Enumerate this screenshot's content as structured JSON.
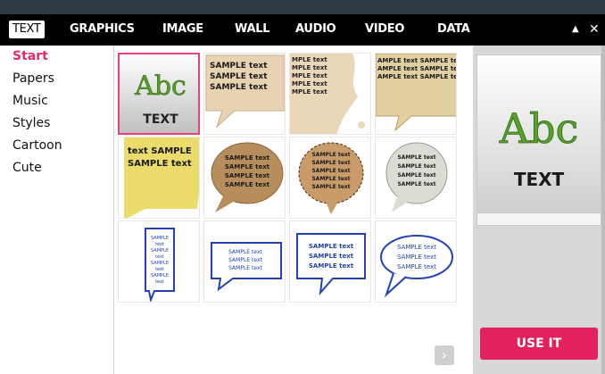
{
  "menu": {
    "tabs": [
      {
        "label": "TEXT"
      },
      {
        "label": "GRAPHICS"
      },
      {
        "label": "IMAGE"
      },
      {
        "label": "WALL"
      },
      {
        "label": "AUDIO"
      },
      {
        "label": "VIDEO"
      },
      {
        "label": "DATA"
      }
    ],
    "minimize_glyph": "▲",
    "close_glyph": "✕"
  },
  "sidebar": {
    "items": [
      {
        "label": "Start",
        "active": true
      },
      {
        "label": "Papers"
      },
      {
        "label": "Music"
      },
      {
        "label": "Styles"
      },
      {
        "label": "Cartoon"
      },
      {
        "label": "Cute"
      }
    ]
  },
  "grid": {
    "items": [
      {
        "style": "abc-text",
        "big": "Abc",
        "small": "TEXT"
      },
      {
        "style": "kraft-speech",
        "text": "SAMPLE text SAMPLE text SAMPLE text"
      },
      {
        "style": "grunge-paper",
        "text": "MPLE text MPLE text MPLE text MPLE text MPLE text"
      },
      {
        "style": "newspaper-bubble",
        "text": "AMPLE text SAMPLE te AMPLE text SAMPLE te AMPLE text SAMPLE te"
      },
      {
        "style": "sticky-note",
        "text": "text SAMPLE SAMPLE text"
      },
      {
        "style": "cardboard-speech",
        "text": "SAMPLE text SAMPLE text SAMPLE text SAMPLE text"
      },
      {
        "style": "stitched-speech",
        "text": "SAMPLE text SAMPLE text SAMPLE text SAMPLE text SAMPLE text"
      },
      {
        "style": "stone-speech",
        "text": "SAMPLE text SAMPLE text SAMPLE text SAMPLE text"
      },
      {
        "style": "blue-scribble-tall",
        "text": "SAMPLE text SAMPLE text SAMPLE text SAMPLE text"
      },
      {
        "style": "blue-scribble-box",
        "text": "SAMPLE text SAMPLE text SAMPLE text"
      },
      {
        "style": "blue-scribble-rect",
        "text": "SAMPLE text SAMPLE text SAMPLE text"
      },
      {
        "style": "blue-scribble-oval",
        "text": "SAMPLE text SAMPLE text SAMPLE text"
      }
    ]
  },
  "preview": {
    "big": "Abc",
    "small": "TEXT"
  },
  "use_it_label": "USE IT",
  "colors": {
    "accent": "#e4215f",
    "active_text": "#e8286a",
    "menubar": "#000000",
    "topstrip": "#2e3b45"
  },
  "icons": {
    "next": "chevron-right-icon"
  }
}
